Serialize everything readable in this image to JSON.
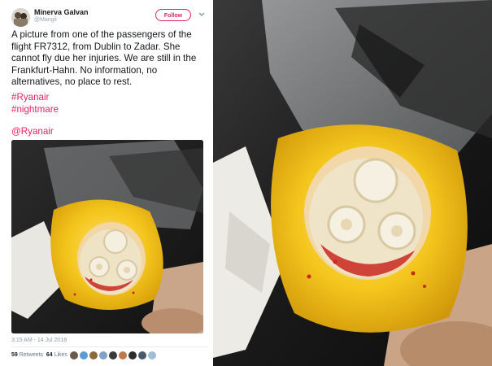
{
  "tweet": {
    "display_name": "Minerva Galvan",
    "handle": "@Mangil",
    "follow_label": "Follow",
    "text": "A picture from one of the passengers of the flight FR7312, from Dublin to Zadar. She cannot fly due her injuries. We are still in the Frankfurt-Hahn. No information, no alternatives, no place to rest.",
    "hashtags": [
      "#Ryanair",
      "#nightmare"
    ],
    "mention": "@Ryanair",
    "timestamp": "3:15 AM - 14 Jul 2018",
    "retweets_count": "59",
    "retweets_label": "Retweets",
    "likes_count": "64",
    "likes_label": "Likes"
  },
  "colors": {
    "accent": "#e0245e",
    "mask_yellow": "#f2c21b",
    "blood": "#c8281f"
  },
  "icons": {
    "menu": "chevron-down-icon"
  }
}
